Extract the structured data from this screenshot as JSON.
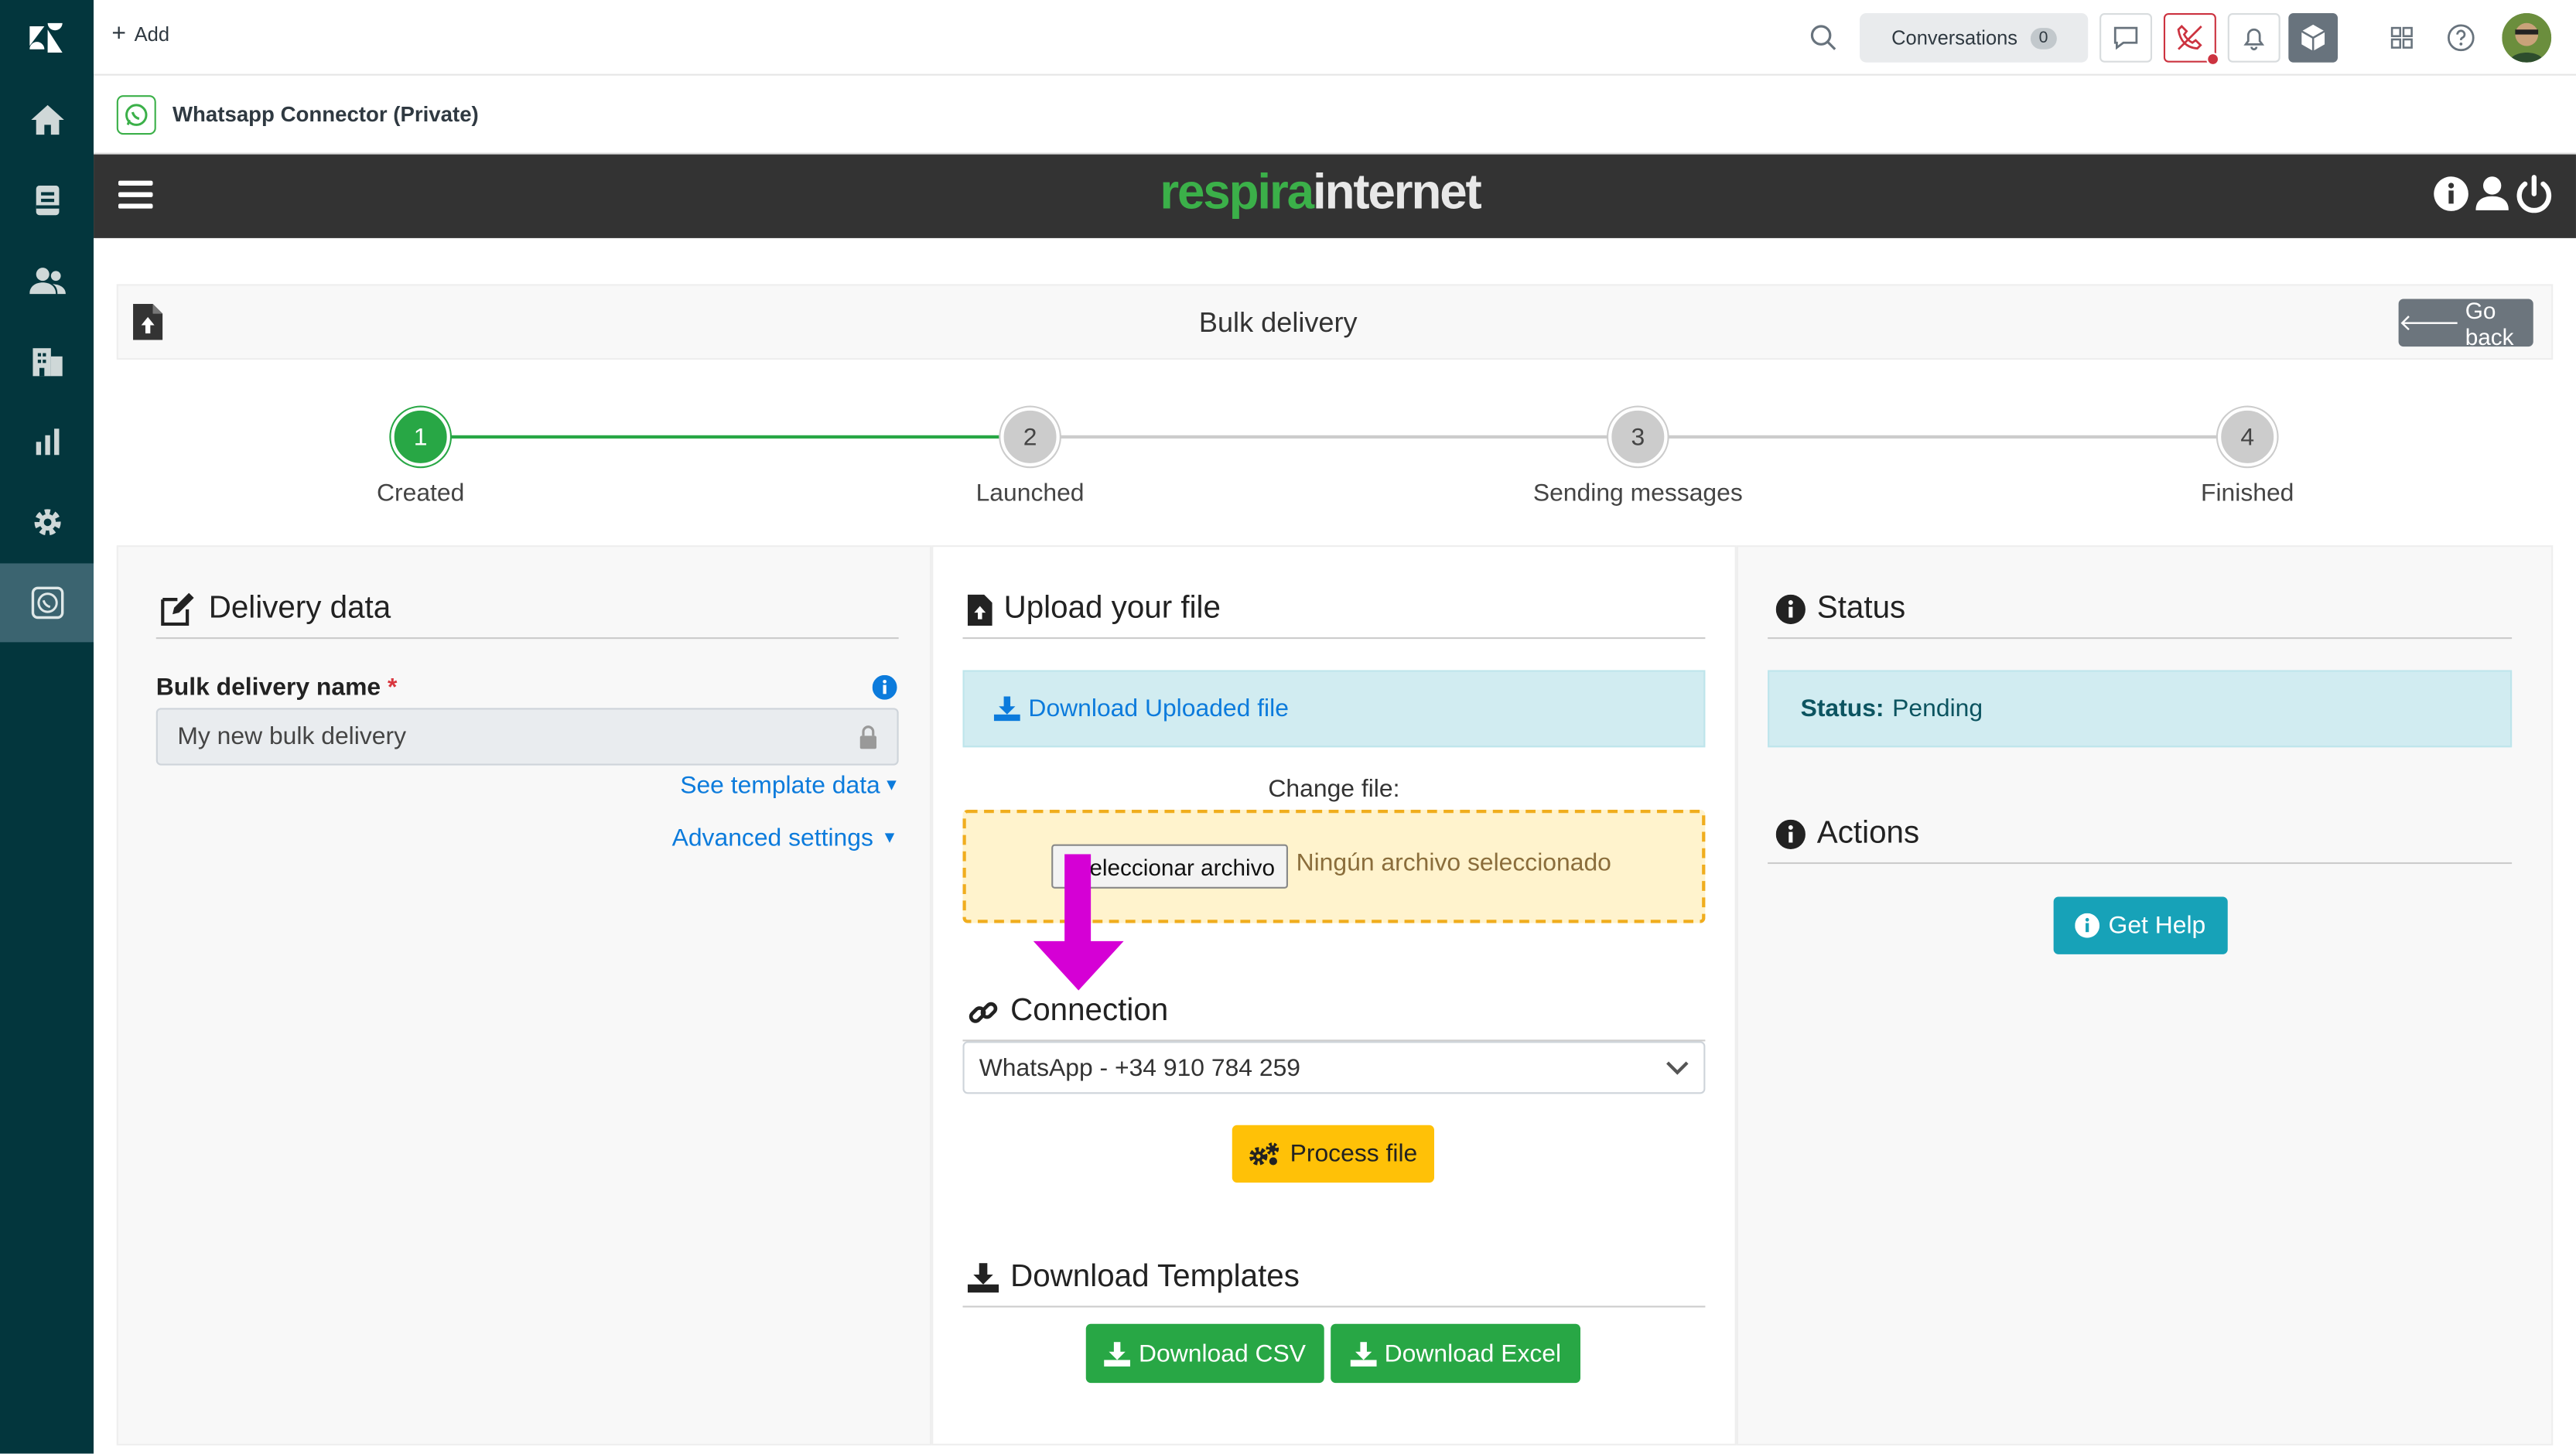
{
  "topbar": {
    "add_label": "Add",
    "conversations_label": "Conversations",
    "conversations_count": "0"
  },
  "app": {
    "title": "Whatsapp Connector (Private)",
    "brand_part1": "respira",
    "brand_part2": "internet"
  },
  "page": {
    "title": "Bulk delivery",
    "go_back": "Go back"
  },
  "stepper": {
    "steps": [
      {
        "number": "1",
        "label": "Created",
        "done": true
      },
      {
        "number": "2",
        "label": "Launched",
        "done": false
      },
      {
        "number": "3",
        "label": "Sending messages",
        "done": false
      },
      {
        "number": "4",
        "label": "Finished",
        "done": false
      }
    ]
  },
  "delivery": {
    "heading": "Delivery data",
    "name_label": "Bulk delivery name",
    "name_required": "*",
    "name_value": "My new bulk delivery",
    "template_link": "See template data",
    "advanced_link": "Advanced settings"
  },
  "upload": {
    "heading": "Upload your file",
    "download_uploaded": "Download Uploaded file",
    "change_file_label": "Change file:",
    "file_button": "Seleccionar archivo",
    "no_file": "Ningún archivo seleccionado"
  },
  "connection": {
    "heading": "Connection",
    "selected": "WhatsApp - +34 910 784 259",
    "process_button": "Process file"
  },
  "templates": {
    "heading": "Download Templates",
    "csv_button": "Download CSV",
    "excel_button": "Download Excel"
  },
  "status": {
    "heading": "Status",
    "status_label": "Status:",
    "status_value": "Pending",
    "actions_heading": "Actions",
    "help_button": "Get Help"
  },
  "colors": {
    "rail": "#03363d",
    "brand_green": "#3bb049",
    "success": "#28a745",
    "warning": "#ffc107",
    "info": "#17a2b8",
    "annotation_arrow": "#d500d5"
  }
}
